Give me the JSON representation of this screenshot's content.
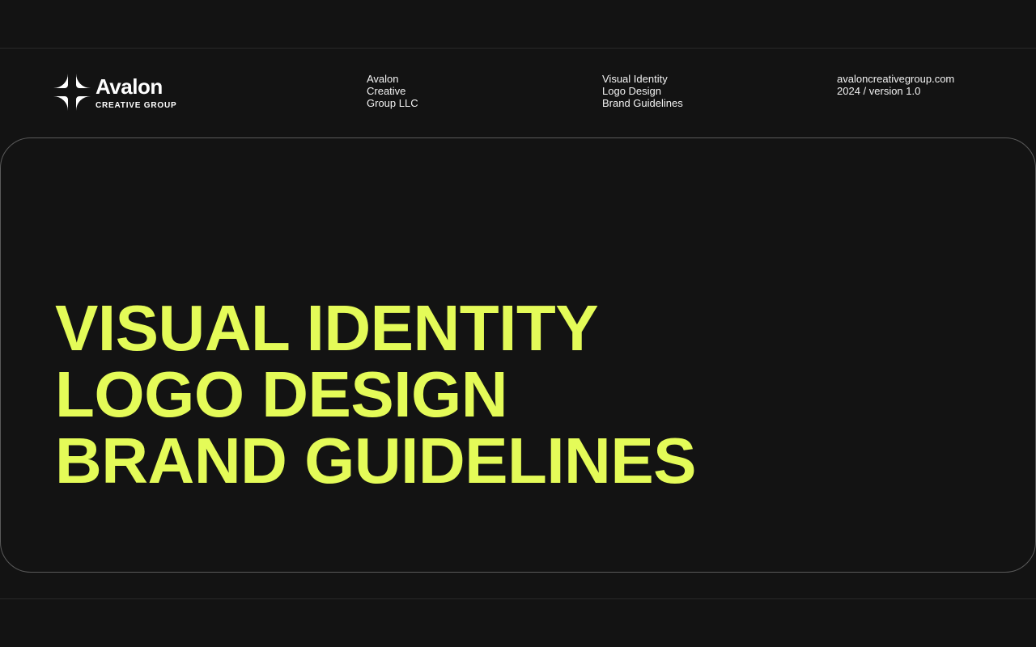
{
  "brand": {
    "logo_icon": "four-arc-star-icon",
    "name": "Avalon",
    "tagline": "CREATIVE GROUP"
  },
  "header": {
    "company": [
      "Avalon",
      "Creative",
      "Group LLC"
    ],
    "services": [
      "Visual Identity",
      "Logo Design",
      "Brand Guidelines"
    ],
    "meta": [
      "avaloncreativegroup.com",
      "2024 / version 1.0"
    ]
  },
  "hero": {
    "lines": [
      "VISUAL IDENTITY",
      "LOGO DESIGN",
      "BRAND GUIDELINES"
    ]
  },
  "colors": {
    "background": "#131313",
    "accent": "#e4fb58",
    "text": "#ffffff",
    "border": "#5a5a5a"
  }
}
